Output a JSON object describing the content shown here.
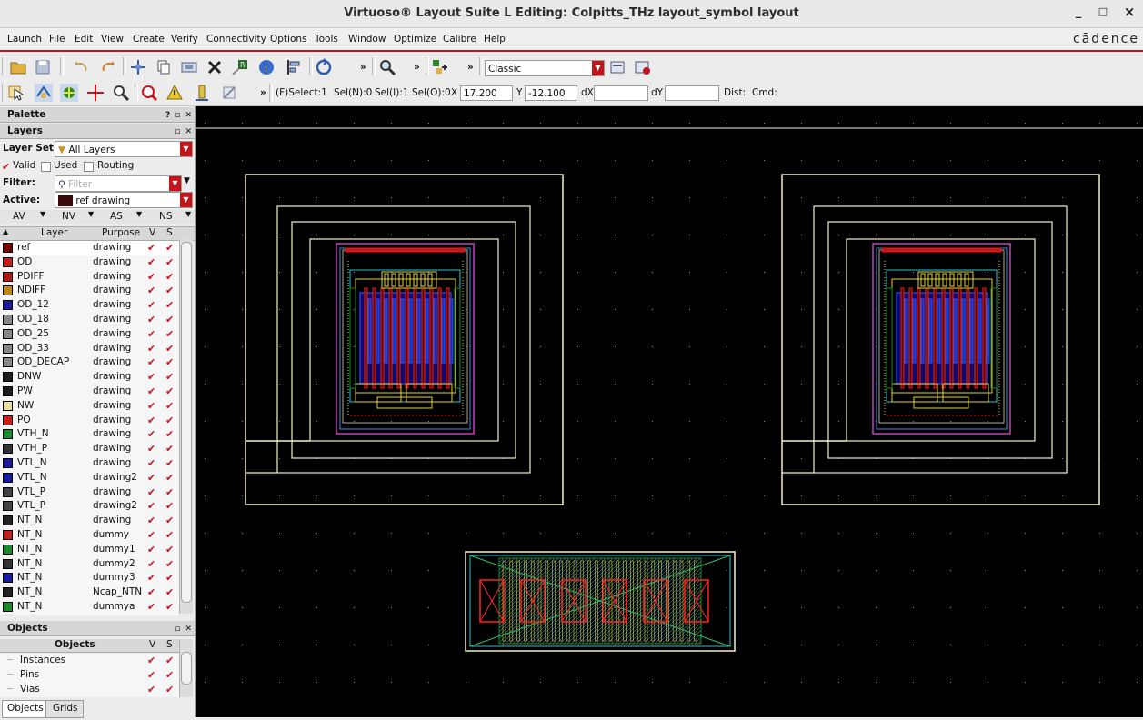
{
  "window": {
    "title": "Virtuoso® Layout Suite L Editing: Colpitts_THz layout_symbol layout",
    "minimize": "_",
    "maximize": "□",
    "close": "×"
  },
  "menu": {
    "items": [
      "Launch",
      "File",
      "Edit",
      "View",
      "Create",
      "Verify",
      "Connectivity",
      "Options",
      "Tools",
      "Window",
      "Optimize",
      "Calibre",
      "Help"
    ],
    "brand": "cādence"
  },
  "toolbar1": {
    "workspace": "Classic"
  },
  "toolbar2": {
    "select_status": "(F)Select:1",
    "sel_n": "Sel(N):0",
    "sel_i": "Sel(I):1",
    "sel_o": "Sel(O):0",
    "x_label": "X",
    "x_value": "17.200",
    "y_label": "Y",
    "y_value": "-12.100",
    "dx_label": "dX",
    "dx_value": "",
    "dy_label": "dY",
    "dy_value": "",
    "dist_label": "Dist:",
    "cmd_label": "Cmd:"
  },
  "palette": {
    "title": "Palette",
    "layers_title": "Layers",
    "layer_set_label": "Layer Set:",
    "layer_set_value": "All Layers",
    "valid_label": "Valid",
    "used_label": "Used",
    "routing_label": "Routing",
    "filter_label": "Filter:",
    "filter_placeholder": "Filter",
    "active_label": "Active:",
    "active_value": "ref drawing",
    "visibility_buttons": [
      "AV",
      "NV",
      "AS",
      "NS"
    ],
    "col_layer": "Layer",
    "col_purpose": "Purpose",
    "col_v": "V",
    "col_s": "S",
    "layers": [
      {
        "name": "ref",
        "purpose": "drawing",
        "color": "#7a0000"
      },
      {
        "name": "OD",
        "purpose": "drawing",
        "color": "#c21f1f"
      },
      {
        "name": "PDIFF",
        "purpose": "drawing",
        "color": "#b01818"
      },
      {
        "name": "NDIFF",
        "purpose": "drawing",
        "color": "#c08a10"
      },
      {
        "name": "OD_12",
        "purpose": "drawing",
        "color": "#1a1a9a"
      },
      {
        "name": "OD_18",
        "purpose": "drawing",
        "color": "#888888"
      },
      {
        "name": "OD_25",
        "purpose": "drawing",
        "color": "#888888"
      },
      {
        "name": "OD_33",
        "purpose": "drawing",
        "color": "#888888"
      },
      {
        "name": "OD_DECAP",
        "purpose": "drawing",
        "color": "#888888"
      },
      {
        "name": "DNW",
        "purpose": "drawing",
        "color": "#1c1c1c"
      },
      {
        "name": "PW",
        "purpose": "drawing",
        "color": "#1c1c1c"
      },
      {
        "name": "NW",
        "purpose": "drawing",
        "color": "#e8e0a0"
      },
      {
        "name": "PO",
        "purpose": "drawing",
        "color": "#d01818"
      },
      {
        "name": "VTH_N",
        "purpose": "drawing",
        "color": "#1a8a2a"
      },
      {
        "name": "VTH_P",
        "purpose": "drawing",
        "color": "#333333"
      },
      {
        "name": "VTL_N",
        "purpose": "drawing",
        "color": "#1a1aa0"
      },
      {
        "name": "VTL_N",
        "purpose": "drawing2",
        "color": "#1a1aa0"
      },
      {
        "name": "VTL_P",
        "purpose": "drawing",
        "color": "#444444"
      },
      {
        "name": "VTL_P",
        "purpose": "drawing2",
        "color": "#444444"
      },
      {
        "name": "NT_N",
        "purpose": "drawing",
        "color": "#222222"
      },
      {
        "name": "NT_N",
        "purpose": "dummy",
        "color": "#c21f1f"
      },
      {
        "name": "NT_N",
        "purpose": "dummy1",
        "color": "#1a8a2a"
      },
      {
        "name": "NT_N",
        "purpose": "dummy2",
        "color": "#333333"
      },
      {
        "name": "NT_N",
        "purpose": "dummy3",
        "color": "#1a1aa0"
      },
      {
        "name": "NT_N",
        "purpose": "Ncap_NTN",
        "color": "#222222"
      },
      {
        "name": "NT_N",
        "purpose": "dummya",
        "color": "#1a8a2a"
      }
    ]
  },
  "objects": {
    "title": "Objects",
    "col_objects": "Objects",
    "col_v": "V",
    "col_s": "S",
    "items": [
      "Instances",
      "Pins",
      "Vias"
    ],
    "tabs": [
      "Objects",
      "Grids"
    ]
  },
  "colors": {
    "accent": "#c6131b",
    "canvas": "#000000",
    "outline": "#f4f1c8"
  }
}
